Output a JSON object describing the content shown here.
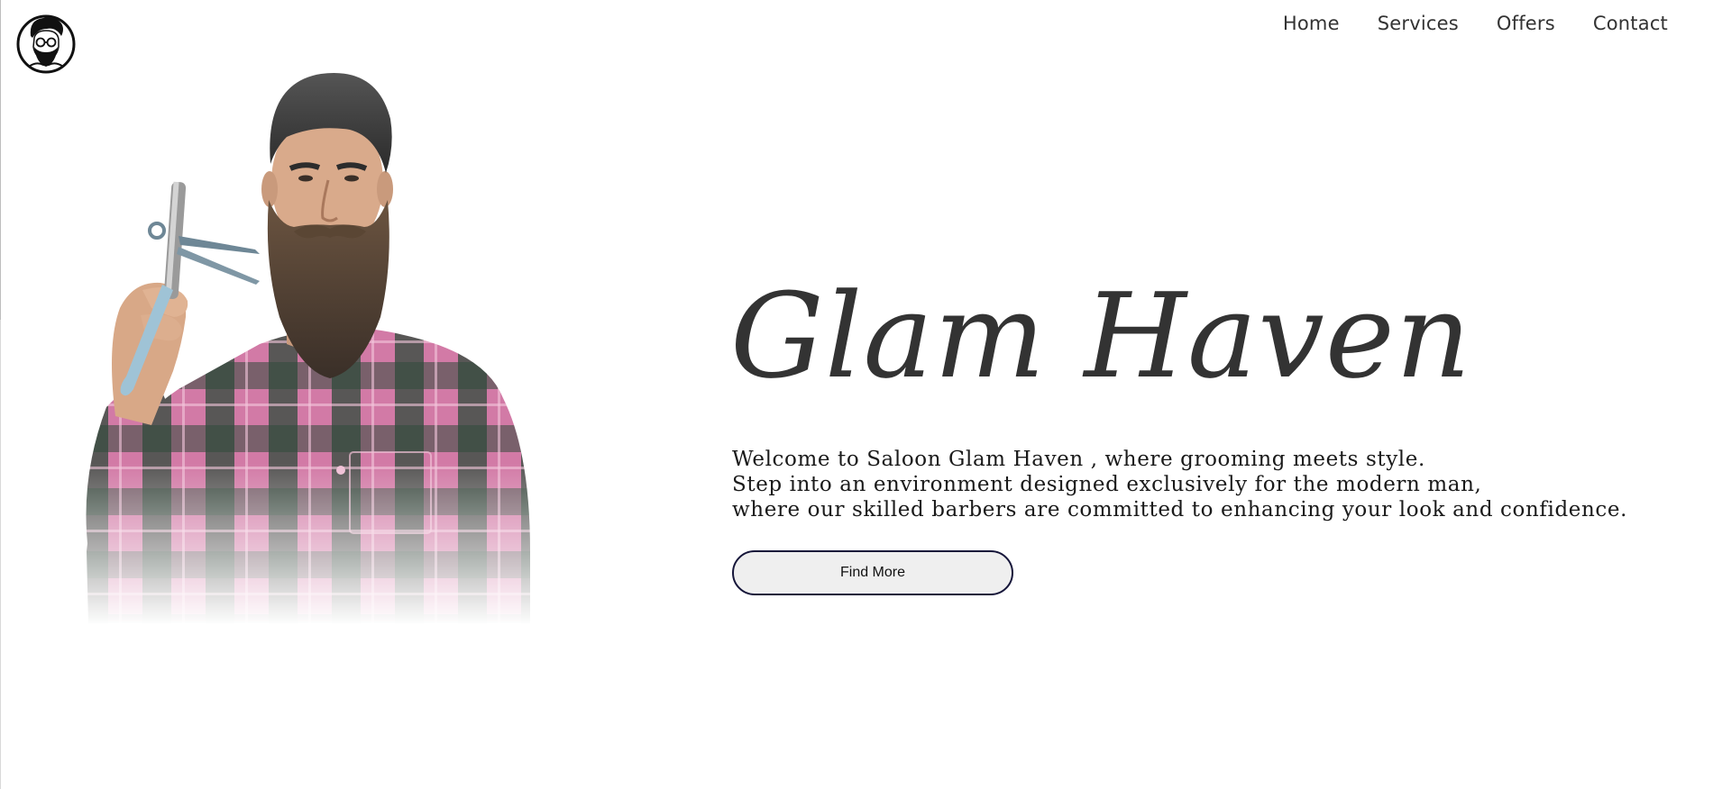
{
  "nav": {
    "items": [
      {
        "label": "Home"
      },
      {
        "label": "Services"
      },
      {
        "label": "Offers"
      },
      {
        "label": "Contact"
      }
    ]
  },
  "hero": {
    "title": "Glam Haven",
    "tagline": [
      "Welcome to Saloon Glam Haven , where grooming meets style.",
      "Step into an environment designed exclusively for the modern man,",
      "where our skilled barbers are committed to enhancing your look and confidence."
    ],
    "cta_label": "Find More"
  },
  "colors": {
    "text": "#333333",
    "button_border": "#16163a",
    "button_bg": "#efefef",
    "shirt_pink": "#d9739f",
    "shirt_green": "#1f3d31"
  },
  "icons": {
    "logo": "bearded-man-logo-icon"
  }
}
